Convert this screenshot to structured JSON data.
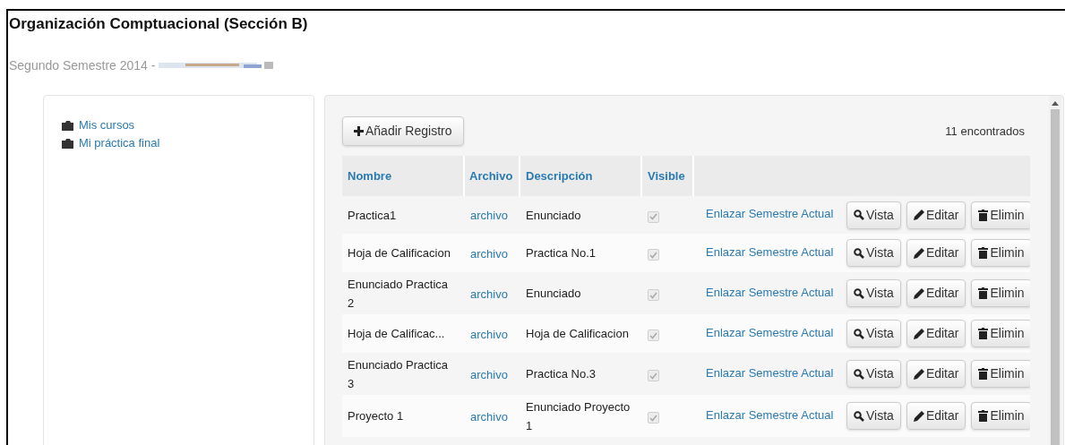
{
  "page": {
    "title": "Organización Comptuacional (Sección B)",
    "subtitle": "Segundo Semestre 2014 -"
  },
  "sidebar": {
    "items": [
      {
        "label": "Mis cursos"
      },
      {
        "label": "Mi práctica final"
      }
    ]
  },
  "toolbar": {
    "add_button": "Añadir Registro",
    "count": "11 encontrados"
  },
  "table": {
    "columns": [
      "Nombre",
      "Archivo",
      "Descripción",
      "Visible"
    ],
    "rows": [
      {
        "nombre": "Practica1",
        "archivo": "archivo",
        "descripcion": "Enunciado",
        "visible": true,
        "link": "Enlazar Semestre Actual",
        "actions": [
          "Vista",
          "Editar",
          "Elimin"
        ]
      },
      {
        "nombre": "Hoja de Calificacion",
        "archivo": "archivo",
        "descripcion": "Practica No.1",
        "visible": true,
        "link": "Enlazar Semestre Actual",
        "actions": [
          "Vista",
          "Editar",
          "Elimin"
        ]
      },
      {
        "nombre": "Enunciado Practica 2",
        "archivo": "archivo",
        "descripcion": "Enunciado",
        "visible": true,
        "link": "Enlazar Semestre Actual",
        "actions": [
          "Vista",
          "Editar",
          "Elimin"
        ]
      },
      {
        "nombre": "Hoja de Calificac...",
        "archivo": "archivo",
        "descripcion": "Hoja de Calificacion",
        "visible": true,
        "link": "Enlazar Semestre Actual",
        "actions": [
          "Vista",
          "Editar",
          "Elimin"
        ]
      },
      {
        "nombre": "Enunciado Practica 3",
        "archivo": "archivo",
        "descripcion": "Practica No.3",
        "visible": true,
        "link": "Enlazar Semestre Actual",
        "actions": [
          "Vista",
          "Editar",
          "Elimin"
        ]
      },
      {
        "nombre": "Proyecto 1",
        "archivo": "archivo",
        "descripcion": "Enunciado Proyecto 1",
        "visible": true,
        "link": "Enlazar Semestre Actual",
        "actions": [
          "Vista",
          "Editar",
          "Elimin"
        ]
      }
    ]
  }
}
